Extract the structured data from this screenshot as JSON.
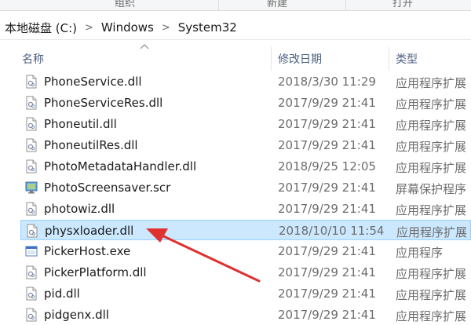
{
  "ribbon": {
    "items": [
      "组织",
      "新建",
      "打开"
    ]
  },
  "address": {
    "crumbs": [
      "本地磁盘 (C:)",
      "Windows",
      "System32"
    ],
    "separator": ">"
  },
  "columns": {
    "name": "名称",
    "date": "修改日期",
    "type": "类型"
  },
  "files": [
    {
      "name": "PhoneService.dll",
      "date": "2018/3/30 11:29",
      "type": "应用程序扩展",
      "icon": "dll-file-icon"
    },
    {
      "name": "PhoneServiceRes.dll",
      "date": "2017/9/29 21:41",
      "type": "应用程序扩展",
      "icon": "dll-file-icon"
    },
    {
      "name": "Phoneutil.dll",
      "date": "2017/9/29 21:41",
      "type": "应用程序扩展",
      "icon": "dll-file-icon"
    },
    {
      "name": "PhoneutilRes.dll",
      "date": "2017/9/29 21:41",
      "type": "应用程序扩展",
      "icon": "dll-file-icon"
    },
    {
      "name": "PhotoMetadataHandler.dll",
      "date": "2018/9/25 12:05",
      "type": "应用程序扩展",
      "icon": "dll-file-icon"
    },
    {
      "name": "PhotoScreensaver.scr",
      "date": "2017/9/29 21:41",
      "type": "屏幕保护程序",
      "icon": "screensaver-file-icon"
    },
    {
      "name": "photowiz.dll",
      "date": "2017/9/29 21:41",
      "type": "应用程序扩展",
      "icon": "dll-file-icon"
    },
    {
      "name": "physxloader.dll",
      "date": "2018/10/10 11:54",
      "type": "应用程序扩展",
      "icon": "dll-file-icon",
      "selected": true
    },
    {
      "name": "PickerHost.exe",
      "date": "2017/9/29 21:41",
      "type": "应用程序",
      "icon": "exe-file-icon"
    },
    {
      "name": "PickerPlatform.dll",
      "date": "2017/9/29 21:41",
      "type": "应用程序扩展",
      "icon": "dll-file-icon"
    },
    {
      "name": "pid.dll",
      "date": "2017/9/29 21:41",
      "type": "应用程序扩展",
      "icon": "dll-file-icon"
    },
    {
      "name": "pidgenx.dll",
      "date": "2017/9/29 21:41",
      "type": "应用程序扩展",
      "icon": "dll-file-icon"
    }
  ],
  "colors": {
    "selection_bg": "#cce8ff",
    "selection_border": "#99d1ff",
    "header_text": "#4d6082",
    "annotation_arrow": "#e03131"
  }
}
